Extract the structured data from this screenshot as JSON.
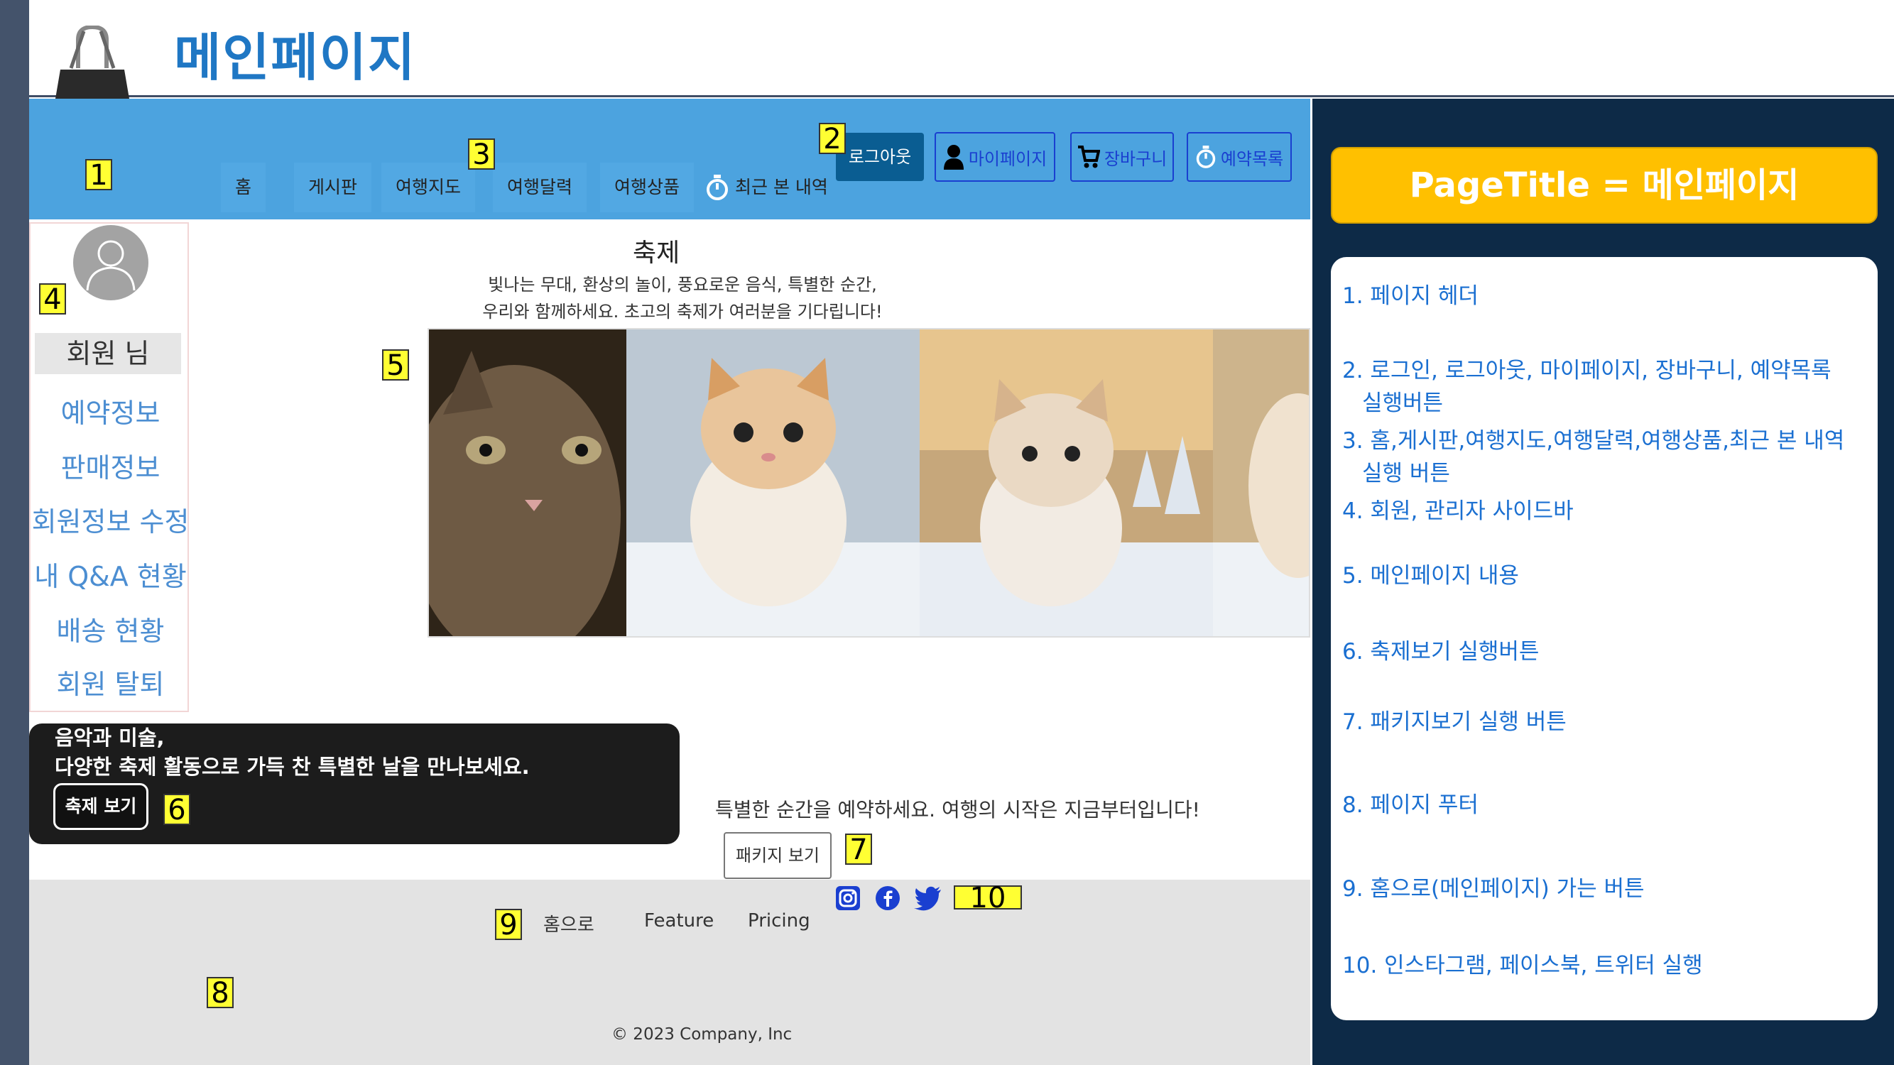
{
  "slide": {
    "title": "메인페이지"
  },
  "header": {
    "nav": [
      "홈",
      "게시판",
      "여행지도",
      "여행달력",
      "여행상품",
      "최근 본 내역"
    ],
    "logout": "로그아웃",
    "mypage": "마이페이지",
    "cart": "장바구니",
    "reservations": "예약목록"
  },
  "sidebar": {
    "member": "회원 님",
    "links": [
      "예약정보",
      "판매정보",
      "회원정보 수정",
      "내 Q&A 현황",
      "배송 현황",
      "회원 탈퇴"
    ]
  },
  "main": {
    "festival_title": "축제",
    "festival_desc_1": "빛나는 무대, 환상의 놀이, 풍요로운 음식, 특별한 순간,",
    "festival_desc_2": "우리와 함께하세요. 초고의 축제가 여러분을 기다립니다!",
    "promo_line_1": "음악과 미술,",
    "promo_line_2": "다양한 축제 활동으로 가득 찬 특별한 날을 만나보세요.",
    "promo_button": "축제 보기",
    "reserve_text": "특별한 순간을 예약하세요. 여행의 시작은 지금부터입니다!",
    "package_button": "패키지 보기"
  },
  "footer": {
    "home": "홈으로",
    "feature": "Feature",
    "pricing": "Pricing",
    "copyright": "© 2023 Company, Inc"
  },
  "markers": [
    "1",
    "2",
    "3",
    "4",
    "5",
    "6",
    "7",
    "8",
    "9",
    "10"
  ],
  "panel": {
    "page_title": "PageTitle  =  메인페이지",
    "notes": [
      "1. 페이지 헤더",
      "2. 로그인, 로그아웃, 마이페이지, 장바구니, 예약목록",
      "실행버튼",
      "3. 홈,게시판,여행지도,여행달력,여행상품,최근 본 내역",
      "실행 버튼",
      "4. 회원, 관리자 사이드바",
      "5. 메인페이지 내용",
      "6. 축제보기 실행버튼",
      "7. 패키지보기 실행 버튼",
      "8. 페이지 푸터",
      "9. 홈으로(메인페이지) 가는 버튼",
      "10. 인스타그램, 페이스북, 트위터 실행"
    ]
  },
  "colors": {
    "header_blue": "#4ca3df",
    "title_blue": "#1f77c4",
    "panel_navy": "#0d2a47",
    "marker_yellow": "#ffff33",
    "page_title_gold": "#ffc000",
    "note_blue": "#1a6fd1"
  }
}
